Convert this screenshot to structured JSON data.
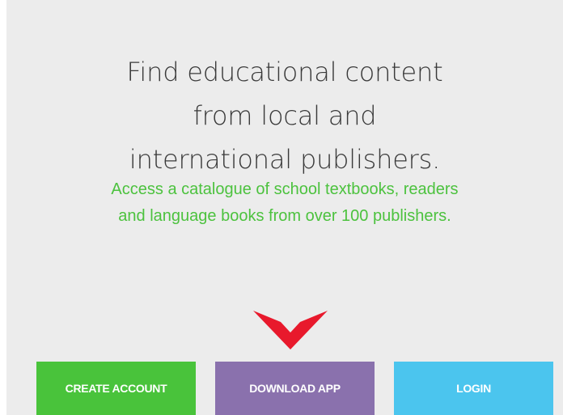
{
  "hero": {
    "headline_lines": [
      "Find educational content",
      "from local and",
      "international publishers."
    ],
    "subline_lines": [
      "Access a catalogue of school textbooks, readers",
      "and language books from over 100 publishers."
    ],
    "scroll_icon": "red-chevron-down-icon"
  },
  "actions": {
    "create_account_label": "CREATE ACCOUNT",
    "download_app_label": "DOWNLOAD APP",
    "login_label": "LOGIN"
  },
  "colors": {
    "background": "#ececec",
    "headline_text": "#3a3a3a",
    "subline_text": "#4cc23e",
    "create_account": "#49c33b",
    "download_app": "#8a71ad",
    "login": "#4bc5ee",
    "chevron": "#e8192c"
  }
}
